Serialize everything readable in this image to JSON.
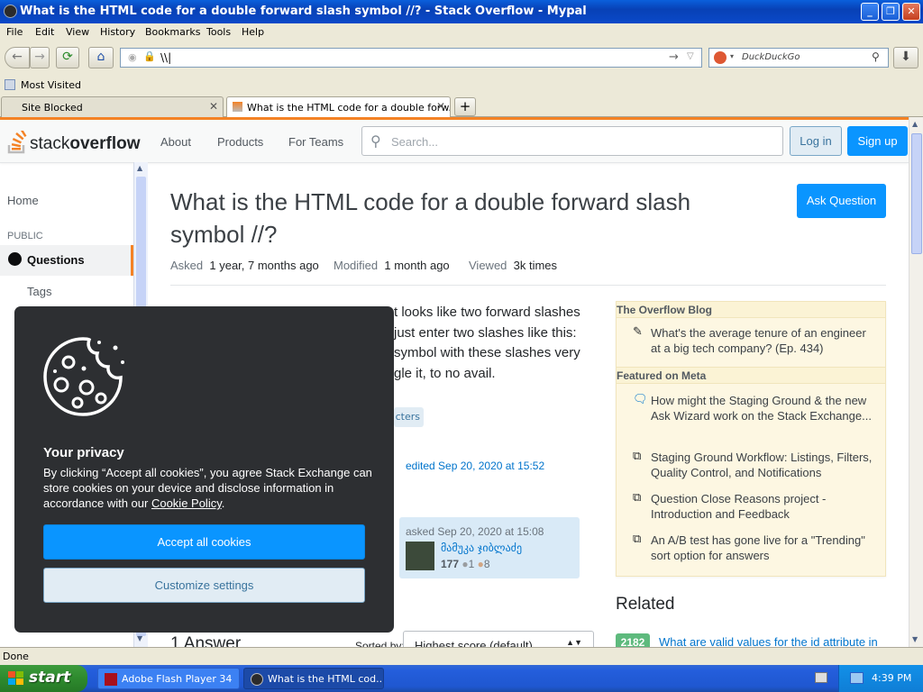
{
  "window": {
    "title": "What is the HTML code for a double forward slash symbol //? - Stack Overflow - Mypal"
  },
  "menu": [
    "File",
    "Edit",
    "View",
    "History",
    "Bookmarks",
    "Tools",
    "Help"
  ],
  "navbar": {
    "url_value": "\\\\|",
    "search_placeholder": "DuckDuckGo"
  },
  "bookmarks": {
    "most_visited": "Most Visited"
  },
  "tabs": [
    {
      "label": "Site Blocked"
    },
    {
      "label": "What is the HTML code for a double forw..."
    }
  ],
  "so": {
    "logo_prefix": "stack",
    "logo_bold": "overflow",
    "nav": [
      "About",
      "Products",
      "For Teams"
    ],
    "search_placeholder": "Search...",
    "login": "Log in",
    "signup": "Sign up"
  },
  "left_sidebar": {
    "home": "Home",
    "public": "PUBLIC",
    "questions": "Questions",
    "tags": "Tags"
  },
  "question": {
    "title": "What is the HTML code for a double forward slash symbol //?",
    "ask_button": "Ask Question",
    "asked_label": "Asked",
    "asked_value": "1 year, 7 months ago",
    "modified_label": "Modified",
    "modified_value": "1 month ago",
    "viewed_label": "Viewed",
    "viewed_value": "3k times",
    "body_lines": [
      "t looks like two forward slashes",
      "just enter two slashes like this:",
      " symbol with these slashes very",
      "gle it, to no avail."
    ],
    "tag_fragment": "cters",
    "edited": "edited Sep 20, 2020 at 15:52",
    "asked_card": "asked Sep 20, 2020 at 15:08",
    "username": "მამუკა ჯიბლაძე",
    "reputation": "177",
    "silver_badges": "1",
    "bronze_badges": "8",
    "answers_heading": "1 Answer",
    "sorted_by": "Sorted by:",
    "sort_value": "Highest score (default)"
  },
  "overflow_blog": {
    "heading": "The Overflow Blog",
    "blog_items": [
      "What's the average tenure of an engineer at a big tech company? (Ep. 434)"
    ],
    "meta_heading": "Featured on Meta",
    "meta_items": [
      "How might the Staging Ground & the new Ask Wizard work on the Stack Exchange...",
      "Staging Ground Workflow: Listings, Filters, Quality Control, and Notifications",
      "Question Close Reasons project - Introduction and Feedback",
      "An A/B test has gone live for a \"Trending\" sort option for answers"
    ]
  },
  "related": {
    "heading": "Related",
    "first_score": "2182",
    "first_title": "What are valid values for the id attribute in"
  },
  "cookie": {
    "title": "Your privacy",
    "text_before": "By clicking “Accept all cookies”, you agree Stack Exchange can store cookies on your device and disclose information in accordance with our ",
    "policy_link": "Cookie Policy",
    "text_after": ".",
    "accept": "Accept all cookies",
    "customize": "Customize settings"
  },
  "status": {
    "text": "Done"
  },
  "taskbar": {
    "start": "start",
    "items": [
      "Adobe Flash Player 34",
      "What is the HTML cod..."
    ],
    "clock": "4:39 PM"
  },
  "colors": {
    "so_orange": "#f48225",
    "so_blue": "#0a95ff",
    "xp_blue": "#0841b6",
    "xp_green": "#2e8a2e"
  }
}
